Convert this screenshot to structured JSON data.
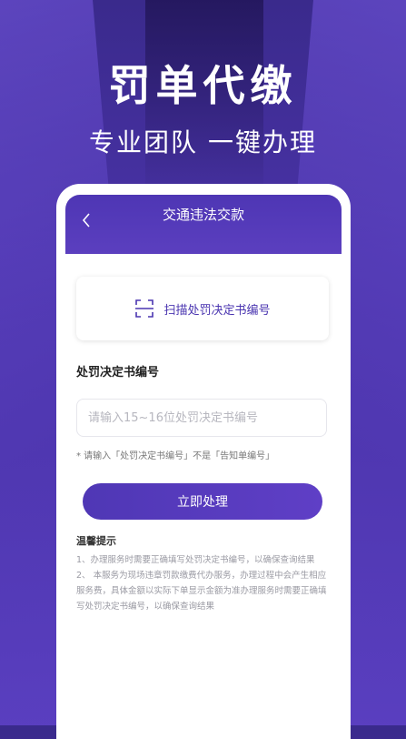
{
  "hero": {
    "title": "罚单代缴",
    "subtitle": "专业团队  一键办理"
  },
  "nav": {
    "back_icon": "chevron-left-icon",
    "title": "交通违法交款"
  },
  "scan": {
    "icon": "scan-icon",
    "label": "扫描处罚决定书编号"
  },
  "form": {
    "label": "处罚决定书编号",
    "placeholder": "请输入15~16位处罚决定书编号",
    "value": "",
    "hint": "* 请输入「处罚决定书编号」不是「告知单编号」"
  },
  "submit_label": "立即处理",
  "tips": {
    "title": "温馨提示",
    "line1": "1、办理服务时需要正确填写处罚决定书编号，以确保查询结果",
    "line2": "2、 本服务为现场违章罚款缴费代办服务，办理过程中会产生相应服务费，具体金额以实际下单显示金额为准办理服务时需要正确填写处罚决定书编号，以确保查询结果"
  },
  "colors": {
    "primary": "#4f37b5",
    "background": "#3a2a8c"
  }
}
